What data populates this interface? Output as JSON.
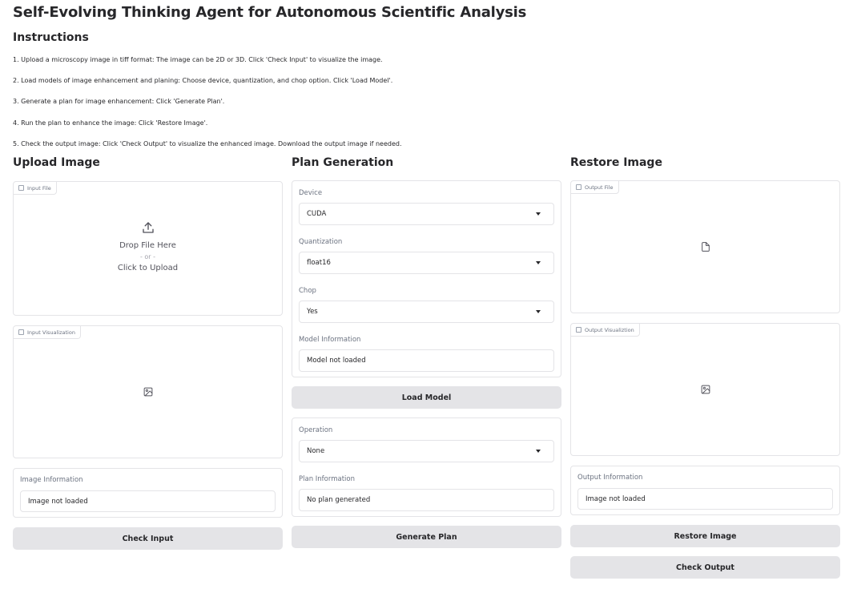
{
  "app": {
    "title": "Self-Evolving Thinking Agent for Autonomous Scientific Analysis"
  },
  "instructions": {
    "title": "Instructions",
    "steps": [
      "1. Upload a microscopy image in tiff format: The image can be 2D or 3D. Click 'Check Input' to visualize the image.",
      "2. Load models of image enhancement and planing: Choose device, quantization, and chop option. Click 'Load Model'.",
      "3. Generate a plan for image enhancement: Click 'Generate Plan'.",
      "4. Run the plan to enhance the image: Click 'Restore Image'.",
      "5. Check the output image: Click 'Check Output' to visualize the enhanced image. Download the output image if needed."
    ]
  },
  "upload": {
    "heading": "Upload Image",
    "input_file_tag": "Input File",
    "drop_text": "Drop File Here",
    "or_text": "- or -",
    "click_text": "Click to Upload",
    "viz_tag": "Input Visualization",
    "info_label": "Image Information",
    "info_value": "Image not loaded",
    "check_button": "Check Input"
  },
  "plan": {
    "heading": "Plan Generation",
    "device_label": "Device",
    "device_value": "CUDA",
    "quant_label": "Quantization",
    "quant_value": "float16",
    "chop_label": "Chop",
    "chop_value": "Yes",
    "model_info_label": "Model Information",
    "model_info_value": "Model not loaded",
    "load_button": "Load Model",
    "operation_label": "Operation",
    "operation_value": "None",
    "plan_info_label": "Plan Information",
    "plan_info_value": "No plan generated",
    "generate_button": "Generate Plan"
  },
  "restore": {
    "heading": "Restore Image",
    "output_file_tag": "Output File",
    "viz_tag": "Output Visualiztion",
    "info_label": "Output Information",
    "info_value": "Image not loaded",
    "restore_button": "Restore Image",
    "check_button": "Check Output"
  },
  "icons": {
    "upload": "upload-icon",
    "file": "file-icon",
    "image": "image-icon",
    "dropdown": "chevron-down-icon"
  },
  "colors": {
    "button_bg": "#e4e4e7",
    "border": "#e4e4e7",
    "text": "#27272a",
    "muted": "#6b7280"
  }
}
